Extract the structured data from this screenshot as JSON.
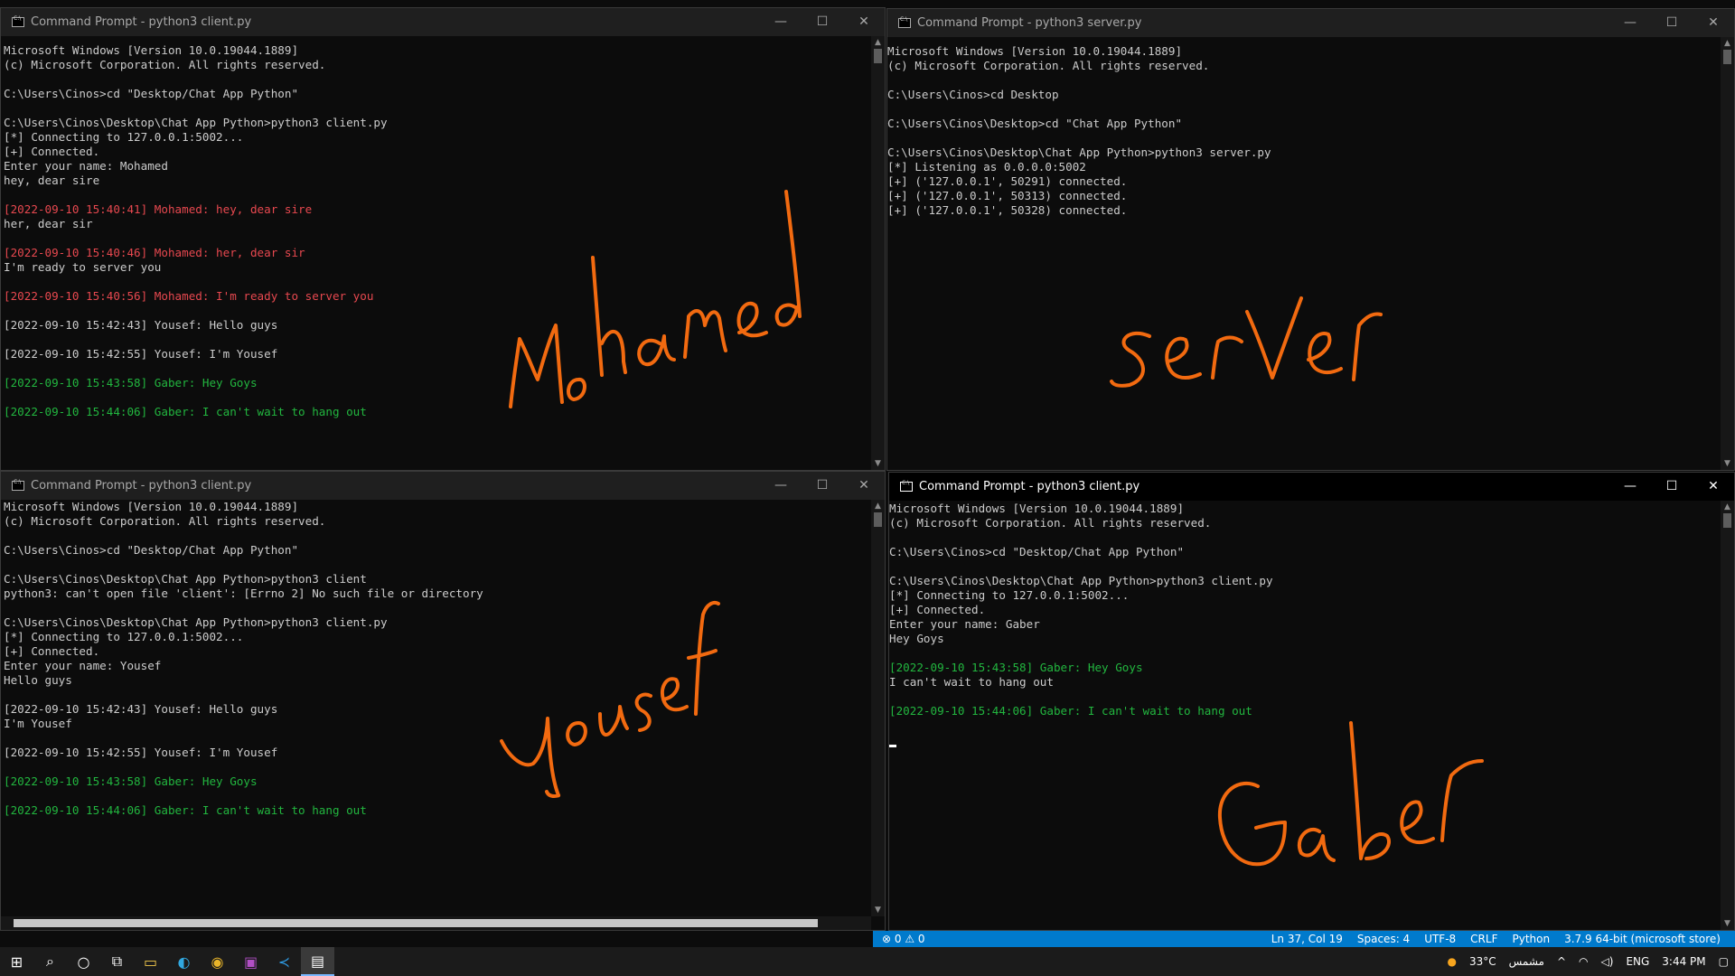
{
  "windows": {
    "top_left": {
      "title": "Command Prompt - python3  client.py",
      "lines": [
        {
          "text": "Microsoft Windows [Version 10.0.19044.1889]",
          "color": "default"
        },
        {
          "text": "(c) Microsoft Corporation. All rights reserved.",
          "color": "default"
        },
        {
          "text": "",
          "color": "default"
        },
        {
          "text": "C:\\Users\\Cinos>cd \"Desktop/Chat App Python\"",
          "color": "default"
        },
        {
          "text": "",
          "color": "default"
        },
        {
          "text": "C:\\Users\\Cinos\\Desktop\\Chat App Python>python3 client.py",
          "color": "default"
        },
        {
          "text": "[*] Connecting to 127.0.0.1:5002...",
          "color": "default"
        },
        {
          "text": "[+] Connected.",
          "color": "default"
        },
        {
          "text": "Enter your name: Mohamed",
          "color": "default"
        },
        {
          "text": "hey, dear sire",
          "color": "default"
        },
        {
          "text": "",
          "color": "default"
        },
        {
          "text": "[2022-09-10 15:40:41] Mohamed: hey, dear sire",
          "color": "red"
        },
        {
          "text": "her, dear sir",
          "color": "default"
        },
        {
          "text": "",
          "color": "default"
        },
        {
          "text": "[2022-09-10 15:40:46] Mohamed: her, dear sir",
          "color": "red"
        },
        {
          "text": "I'm ready to server you",
          "color": "default"
        },
        {
          "text": "",
          "color": "default"
        },
        {
          "text": "[2022-09-10 15:40:56] Mohamed: I'm ready to server you",
          "color": "red"
        },
        {
          "text": "",
          "color": "default"
        },
        {
          "text": "[2022-09-10 15:42:43] Yousef: Hello guys",
          "color": "default"
        },
        {
          "text": "",
          "color": "default"
        },
        {
          "text": "[2022-09-10 15:42:55] Yousef: I'm Yousef",
          "color": "default"
        },
        {
          "text": "",
          "color": "default"
        },
        {
          "text": "[2022-09-10 15:43:58] Gaber: Hey Goys",
          "color": "green"
        },
        {
          "text": "",
          "color": "default"
        },
        {
          "text": "[2022-09-10 15:44:06] Gaber: I can't wait to hang out",
          "color": "green"
        }
      ]
    },
    "top_right": {
      "title": "Command Prompt - python3  server.py",
      "lines": [
        {
          "text": "Microsoft Windows [Version 10.0.19044.1889]",
          "color": "default"
        },
        {
          "text": "(c) Microsoft Corporation. All rights reserved.",
          "color": "default"
        },
        {
          "text": "",
          "color": "default"
        },
        {
          "text": "C:\\Users\\Cinos>cd Desktop",
          "color": "default"
        },
        {
          "text": "",
          "color": "default"
        },
        {
          "text": "C:\\Users\\Cinos\\Desktop>cd \"Chat App Python\"",
          "color": "default"
        },
        {
          "text": "",
          "color": "default"
        },
        {
          "text": "C:\\Users\\Cinos\\Desktop\\Chat App Python>python3 server.py",
          "color": "default"
        },
        {
          "text": "[*] Listening as 0.0.0.0:5002",
          "color": "default"
        },
        {
          "text": "[+] ('127.0.0.1', 50291) connected.",
          "color": "default"
        },
        {
          "text": "[+] ('127.0.0.1', 50313) connected.",
          "color": "default"
        },
        {
          "text": "[+] ('127.0.0.1', 50328) connected.",
          "color": "default"
        }
      ]
    },
    "bottom_left": {
      "title": "Command Prompt - python3  client.py",
      "lines": [
        {
          "text": "Microsoft Windows [Version 10.0.19044.1889]",
          "color": "default"
        },
        {
          "text": "(c) Microsoft Corporation. All rights reserved.",
          "color": "default"
        },
        {
          "text": "",
          "color": "default"
        },
        {
          "text": "C:\\Users\\Cinos>cd \"Desktop/Chat App Python\"",
          "color": "default"
        },
        {
          "text": "",
          "color": "default"
        },
        {
          "text": "C:\\Users\\Cinos\\Desktop\\Chat App Python>python3 client",
          "color": "default"
        },
        {
          "text": "python3: can't open file 'client': [Errno 2] No such file or directory",
          "color": "default"
        },
        {
          "text": "",
          "color": "default"
        },
        {
          "text": "C:\\Users\\Cinos\\Desktop\\Chat App Python>python3 client.py",
          "color": "default"
        },
        {
          "text": "[*] Connecting to 127.0.0.1:5002...",
          "color": "default"
        },
        {
          "text": "[+] Connected.",
          "color": "default"
        },
        {
          "text": "Enter your name: Yousef",
          "color": "default"
        },
        {
          "text": "Hello guys",
          "color": "default"
        },
        {
          "text": "",
          "color": "default"
        },
        {
          "text": "[2022-09-10 15:42:43] Yousef: Hello guys",
          "color": "default"
        },
        {
          "text": "I'm Yousef",
          "color": "default"
        },
        {
          "text": "",
          "color": "default"
        },
        {
          "text": "[2022-09-10 15:42:55] Yousef: I'm Yousef",
          "color": "default"
        },
        {
          "text": "",
          "color": "default"
        },
        {
          "text": "[2022-09-10 15:43:58] Gaber: Hey Goys",
          "color": "green"
        },
        {
          "text": "",
          "color": "default"
        },
        {
          "text": "[2022-09-10 15:44:06] Gaber: I can't wait to hang out",
          "color": "green"
        }
      ]
    },
    "bottom_right": {
      "title": "Command Prompt - python3  client.py",
      "lines": [
        {
          "text": "Microsoft Windows [Version 10.0.19044.1889]",
          "color": "default"
        },
        {
          "text": "(c) Microsoft Corporation. All rights reserved.",
          "color": "default"
        },
        {
          "text": "",
          "color": "default"
        },
        {
          "text": "C:\\Users\\Cinos>cd \"Desktop/Chat App Python\"",
          "color": "default"
        },
        {
          "text": "",
          "color": "default"
        },
        {
          "text": "C:\\Users\\Cinos\\Desktop\\Chat App Python>python3 client.py",
          "color": "default"
        },
        {
          "text": "[*] Connecting to 127.0.0.1:5002...",
          "color": "default"
        },
        {
          "text": "[+] Connected.",
          "color": "default"
        },
        {
          "text": "Enter your name: Gaber",
          "color": "default"
        },
        {
          "text": "Hey Goys",
          "color": "default"
        },
        {
          "text": "",
          "color": "default"
        },
        {
          "text": "[2022-09-10 15:43:58] Gaber: Hey Goys",
          "color": "green"
        },
        {
          "text": "I can't wait to hang out",
          "color": "default"
        },
        {
          "text": "",
          "color": "default"
        },
        {
          "text": "[2022-09-10 15:44:06] Gaber: I can't wait to hang out",
          "color": "green"
        }
      ]
    }
  },
  "window_controls": {
    "minimize": "—",
    "maximize": "☐",
    "close": "✕"
  },
  "annotations": {
    "top_left": "Mohamed",
    "top_right": "server",
    "bottom_left": "Yousef",
    "bottom_right": "Gaber",
    "ink_color": "#f26a10"
  },
  "colors": {
    "red": "#e7484f",
    "green": "#22b63f",
    "default": "#cccccc",
    "statusbar": "#007acc"
  },
  "statusbar": {
    "problems": "⊗ 0 ⚠ 0",
    "position": "Ln 37, Col 19",
    "spaces": "Spaces: 4",
    "encoding": "UTF-8",
    "eol": "CRLF",
    "language": "Python",
    "interpreter": "3.7.9 64-bit (microsoft store)"
  },
  "taskbar": {
    "apps": [
      "windows-start-icon",
      "search-icon",
      "cortana-icon",
      "task-view-icon",
      "file-explorer-icon",
      "edge-icon",
      "chrome-icon",
      "onenote-icon",
      "vscode-icon",
      "command-prompt-icon"
    ],
    "weather": "33°C",
    "weather_text": "مشمس",
    "language": "ENG",
    "time": "3:44 PM"
  }
}
